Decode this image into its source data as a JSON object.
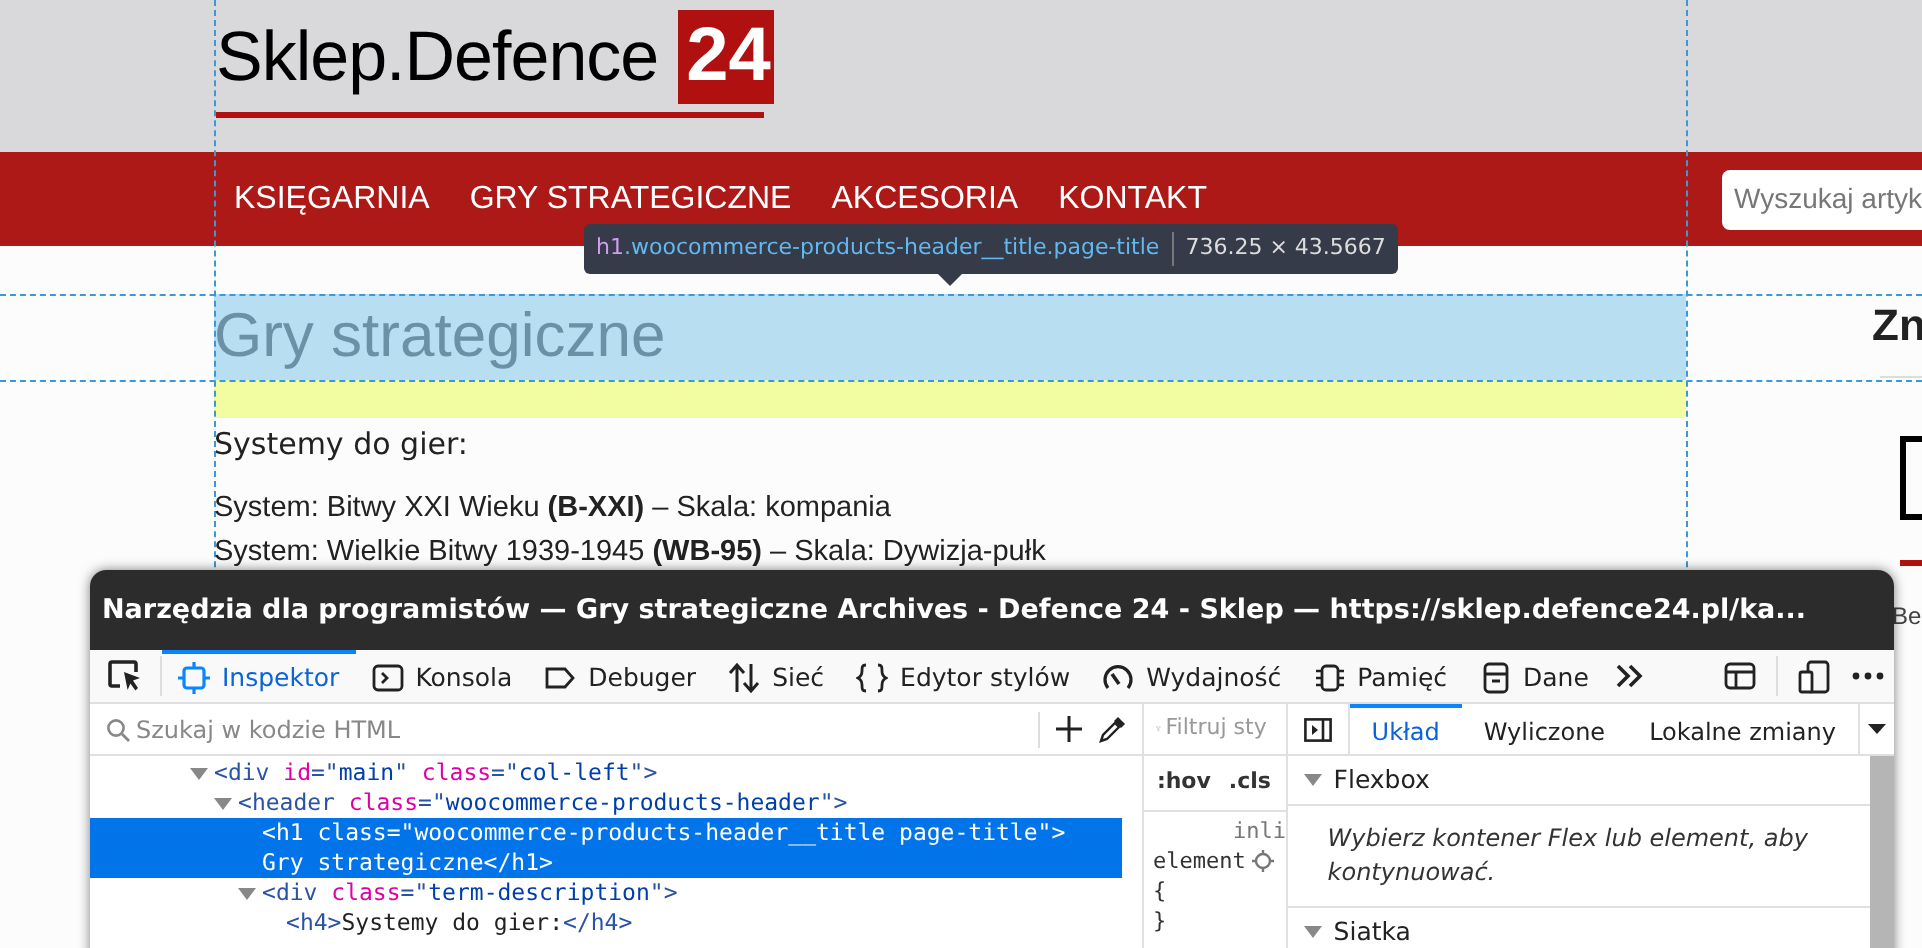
{
  "site": {
    "logo_text": "Sklep.Defence",
    "logo_badge": "24",
    "nav": [
      {
        "label": "KSIĘGARNIA"
      },
      {
        "label": "GRY STRATEGICZNE"
      },
      {
        "label": "AKCESORIA"
      },
      {
        "label": "KONTAKT"
      }
    ],
    "search": {
      "placeholder": "Wyszukaj artyk"
    }
  },
  "highlight_tooltip": {
    "tag": "h1",
    "selector": ".woocommerce-products-header__title.page-title",
    "size": "736.25 × 43.5667"
  },
  "content": {
    "title": "Gry strategiczne",
    "subtitle": "Systemy do gier:",
    "lines": [
      "System: Bitwy XXI Wieku **(B-XXI)** – Skala: kompania",
      "System: Wielkie Bitwy 1939-1945 **(WB-95)** – Skala: Dywizja-pułk"
    ],
    "sidebar_heading": "Zn",
    "sidebar_text": "Be"
  },
  "devtools": {
    "title": "Narzędzia dla programistów — Gry strategiczne Archives - Defence 24 - Sklep — https://sklep.defence24.pl/ka...",
    "tabs": [
      {
        "label": "Inspektor",
        "selected": true
      },
      {
        "label": "Konsola",
        "selected": false
      },
      {
        "label": "Debuger",
        "selected": false
      },
      {
        "label": "Sieć",
        "selected": false
      },
      {
        "label": "Edytor stylów",
        "selected": false
      },
      {
        "label": "Wydajność",
        "selected": false
      },
      {
        "label": "Pamięć",
        "selected": false
      },
      {
        "label": "Dane",
        "selected": false
      }
    ],
    "search": {
      "placeholder": "Szukaj w kodzie HTML"
    },
    "tree": [
      {
        "expanded": true,
        "selected": false,
        "lines": [
          [
            {
              "kind": "punct",
              "text": "<"
            },
            {
              "kind": "tag",
              "text": "div"
            },
            {
              "kind": "attr",
              "text": "id"
            },
            {
              "kind": "punct",
              "text": "=\""
            },
            {
              "kind": "value",
              "text": "main"
            },
            {
              "kind": "punct",
              "text": "\""
            },
            {
              "kind": "attr",
              "text": "class"
            },
            {
              "kind": "punct",
              "text": "=\""
            },
            {
              "kind": "value",
              "text": "col-left"
            },
            {
              "kind": "punct",
              "text": "\">"
            }
          ]
        ],
        "children": [
          {
            "expanded": true,
            "selected": false,
            "lines": [
              [
                {
                  "kind": "punct",
                  "text": "<"
                },
                {
                  "kind": "tag",
                  "text": "header"
                },
                {
                  "kind": "attr",
                  "text": "class"
                },
                {
                  "kind": "punct",
                  "text": "=\""
                },
                {
                  "kind": "value",
                  "text": "woocommerce-products-header"
                },
                {
                  "kind": "punct",
                  "text": "\">"
                }
              ]
            ],
            "children": [
              {
                "selected": true,
                "lines": [
                  [
                    {
                      "kind": "punct",
                      "text": "<"
                    },
                    {
                      "kind": "tag",
                      "text": "h1"
                    },
                    {
                      "kind": "attr",
                      "text": "class"
                    },
                    {
                      "kind": "punct",
                      "text": "=\""
                    },
                    {
                      "kind": "value",
                      "text": "woocommerce-products-header__title page-title"
                    },
                    {
                      "kind": "punct",
                      "text": "\">"
                    }
                  ],
                  [
                    {
                      "kind": "plain",
                      "text": "Gry strategiczne"
                    },
                    {
                      "kind": "punct",
                      "text": "</"
                    },
                    {
                      "kind": "tag",
                      "text": "h1"
                    },
                    {
                      "kind": "punct",
                      "text": ">"
                    }
                  ]
                ]
              },
              {
                "expanded": true,
                "selected": false,
                "lines": [
                  [
                    {
                      "kind": "punct",
                      "text": "<"
                    },
                    {
                      "kind": "tag",
                      "text": "div"
                    },
                    {
                      "kind": "attr",
                      "text": "class"
                    },
                    {
                      "kind": "punct",
                      "text": "=\""
                    },
                    {
                      "kind": "value",
                      "text": "term-description"
                    },
                    {
                      "kind": "punct",
                      "text": "\">"
                    }
                  ]
                ],
                "children": [
                  {
                    "selected": false,
                    "lines": [
                      [
                        {
                          "kind": "punct",
                          "text": "<"
                        },
                        {
                          "kind": "tag",
                          "text": "h4"
                        },
                        {
                          "kind": "punct",
                          "text": ">"
                        },
                        {
                          "kind": "plain",
                          "text": "Systemy do gier:"
                        },
                        {
                          "kind": "punct",
                          "text": "</"
                        },
                        {
                          "kind": "tag",
                          "text": "h4"
                        },
                        {
                          "kind": "punct",
                          "text": ">"
                        }
                      ]
                    ]
                  }
                ]
              }
            ]
          }
        ]
      }
    ],
    "rules": {
      "filter_placeholder": "Filtruj sty",
      "pseudo_toggles": [
        ":hov",
        ".cls"
      ],
      "inline_label": "inli",
      "element_label": "element",
      "open_brace": "{",
      "close_brace": "}"
    },
    "layout_tabs": [
      {
        "label": "Układ",
        "selected": true
      },
      {
        "label": "Wyliczone",
        "selected": false
      },
      {
        "label": "Lokalne zmiany",
        "selected": false
      }
    ],
    "sections": [
      {
        "title": "Flexbox",
        "expanded": true,
        "message": "Wybierz kontener Flex lub element, aby kontynuować."
      },
      {
        "title": "Siatka",
        "expanded": true
      }
    ]
  }
}
